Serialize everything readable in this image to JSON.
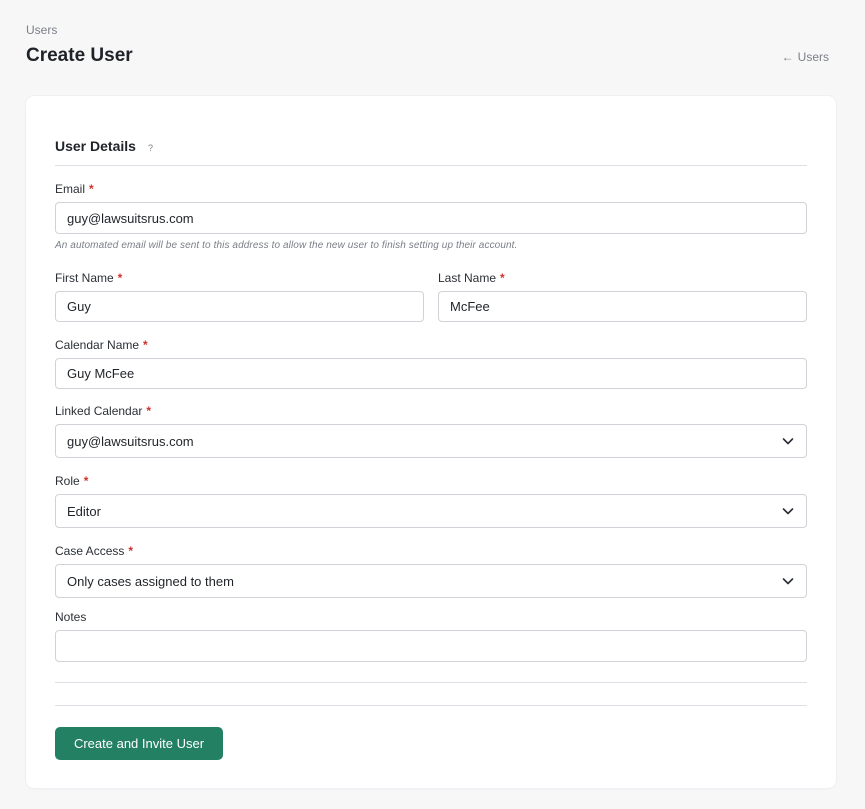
{
  "breadcrumb": "Users",
  "page_title": "Create User",
  "back_link": {
    "arrow": "←",
    "label": "Users"
  },
  "section": {
    "title": "User Details",
    "help": "?"
  },
  "required_mark": "*",
  "fields": {
    "email": {
      "label": "Email",
      "value": "guy@lawsuitsrus.com",
      "hint": "An automated email will be sent to this address to allow the new user to finish setting up their account."
    },
    "first_name": {
      "label": "First Name",
      "value": "Guy"
    },
    "last_name": {
      "label": "Last Name",
      "value": "McFee"
    },
    "calendar_name": {
      "label": "Calendar Name",
      "value": "Guy McFee"
    },
    "linked_calendar": {
      "label": "Linked Calendar",
      "value": "guy@lawsuitsrus.com"
    },
    "role": {
      "label": "Role",
      "value": "Editor"
    },
    "case_access": {
      "label": "Case Access",
      "value": "Only cases assigned to them"
    },
    "notes": {
      "label": "Notes",
      "value": ""
    }
  },
  "submit_label": "Create and Invite User",
  "colors": {
    "primary": "#238063",
    "required": "#d0312d"
  }
}
